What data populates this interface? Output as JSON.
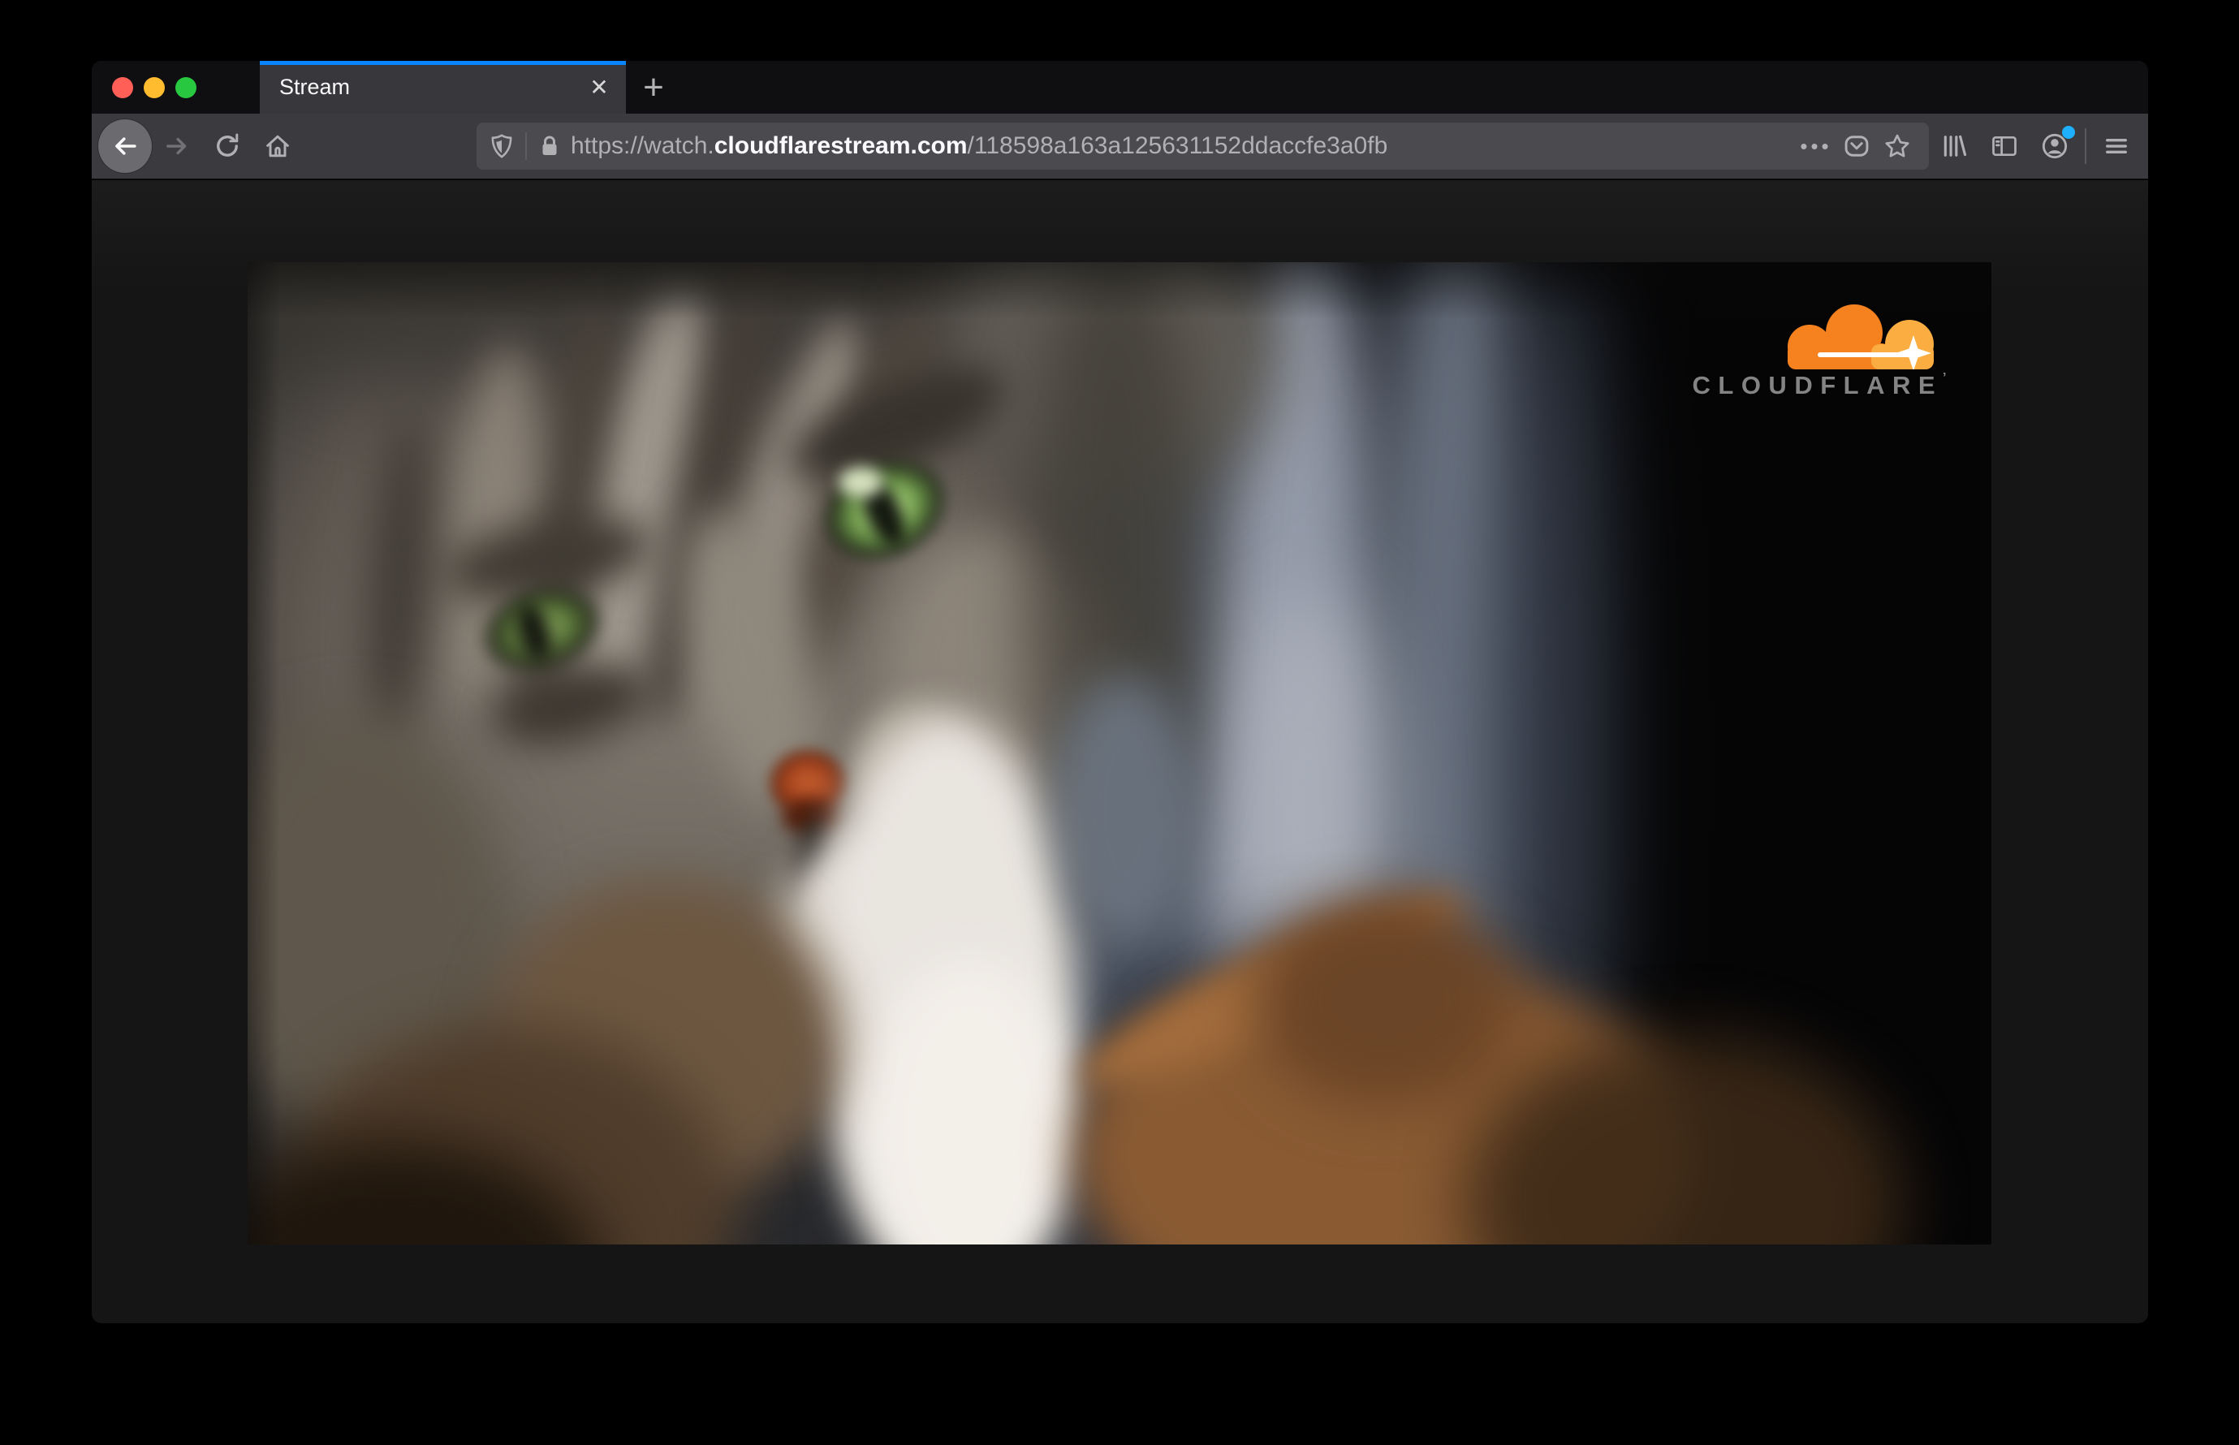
{
  "browser": {
    "tab_strip": {
      "active_tab_title": "Stream",
      "close_glyph": "✕",
      "new_tab_glyph": "+"
    },
    "toolbar": {
      "page_actions_glyph": "•••"
    },
    "address": {
      "prefix": "https://watch.",
      "host": "cloudflarestream.com",
      "path": "/118598a163a125631152ddaccfe3a0fb"
    },
    "colors": {
      "accent_blue": "#0a84ff",
      "notification_dot": "#1fb0fd",
      "traffic_red": "#ff5f57",
      "traffic_yellow": "#febc2e",
      "traffic_green": "#28c840"
    }
  },
  "video": {
    "logo": {
      "text": "CLOUDFLARE",
      "tm": "’",
      "orange": "#f6821f",
      "orange_light": "#fbad41"
    }
  }
}
